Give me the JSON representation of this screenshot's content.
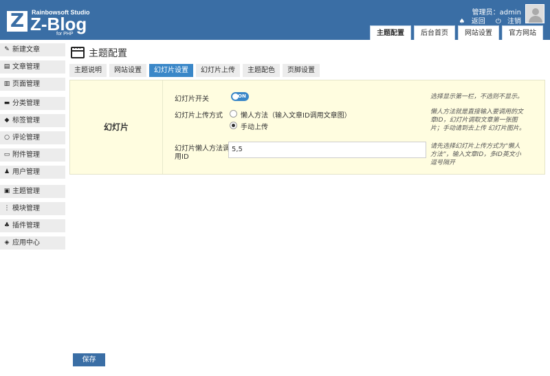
{
  "brand": {
    "letter": "Z",
    "studio": "Rainbowsoft Studio",
    "name": "Z-Blog",
    "sub": "for PHP"
  },
  "user": {
    "line": "管理员：admin",
    "back": "返回",
    "logout": "注销"
  },
  "top_tabs": [
    {
      "label": "主题配置",
      "active": true
    },
    {
      "label": "后台首页",
      "active": false
    },
    {
      "label": "网站设置",
      "active": false
    },
    {
      "label": "官方网站",
      "active": false
    }
  ],
  "sidebar": {
    "items": [
      {
        "label": "新建文章",
        "icon": "edit-icon"
      },
      {
        "label": "文章管理",
        "icon": "article-icon"
      },
      {
        "label": "页面管理",
        "icon": "page-icon"
      },
      {
        "label": "分类管理",
        "icon": "folder-icon"
      },
      {
        "label": "标签管理",
        "icon": "tag-icon"
      },
      {
        "label": "评论管理",
        "icon": "comment-icon"
      },
      {
        "label": "附件管理",
        "icon": "attachment-icon"
      },
      {
        "label": "用户管理",
        "icon": "user-icon"
      },
      {
        "label": "主题管理",
        "icon": "theme-icon"
      },
      {
        "label": "模块管理",
        "icon": "module-icon"
      },
      {
        "label": "插件管理",
        "icon": "plugin-icon"
      },
      {
        "label": "应用中心",
        "icon": "app-center-icon"
      }
    ]
  },
  "page": {
    "title": "主题配置"
  },
  "sub_tabs": [
    {
      "label": "主题说明",
      "active": false
    },
    {
      "label": "网站设置",
      "active": false
    },
    {
      "label": "幻灯片设置",
      "active": true
    },
    {
      "label": "幻灯片上传",
      "active": false
    },
    {
      "label": "主题配色",
      "active": false
    },
    {
      "label": "页脚设置",
      "active": false
    }
  ],
  "panel": {
    "section_label": "幻灯片",
    "switch_label": "幻灯片开关",
    "switch_state": "ON",
    "switch_hint": "选择显示第一栏，不选则不显示。",
    "method_label": "幻灯片上传方式",
    "method_options": [
      "懒人方法（输入文章ID调用文章图）",
      "手动上传"
    ],
    "method_selected": 1,
    "method_hint_1": "懒人方法就是直接输入要调用的文",
    "method_hint_2": "章ID，幻灯片调取文章第一张图",
    "method_hint_3": "片；手动请到去上传 幻灯片图片。",
    "ids_label_1": "幻灯片懒人方法调",
    "ids_label_2": "用ID",
    "ids_value": "5,5",
    "ids_hint_1": "请先选择幻灯片上传方式为“懒人",
    "ids_hint_2": "方法”，输入文章ID，多ID英文小",
    "ids_hint_3": "逗号隔开"
  },
  "actions": {
    "save": "保存"
  },
  "colors": {
    "header": "#3a6ea5",
    "active_tab": "#3a87c8",
    "panel_bg": "#fffde0"
  }
}
